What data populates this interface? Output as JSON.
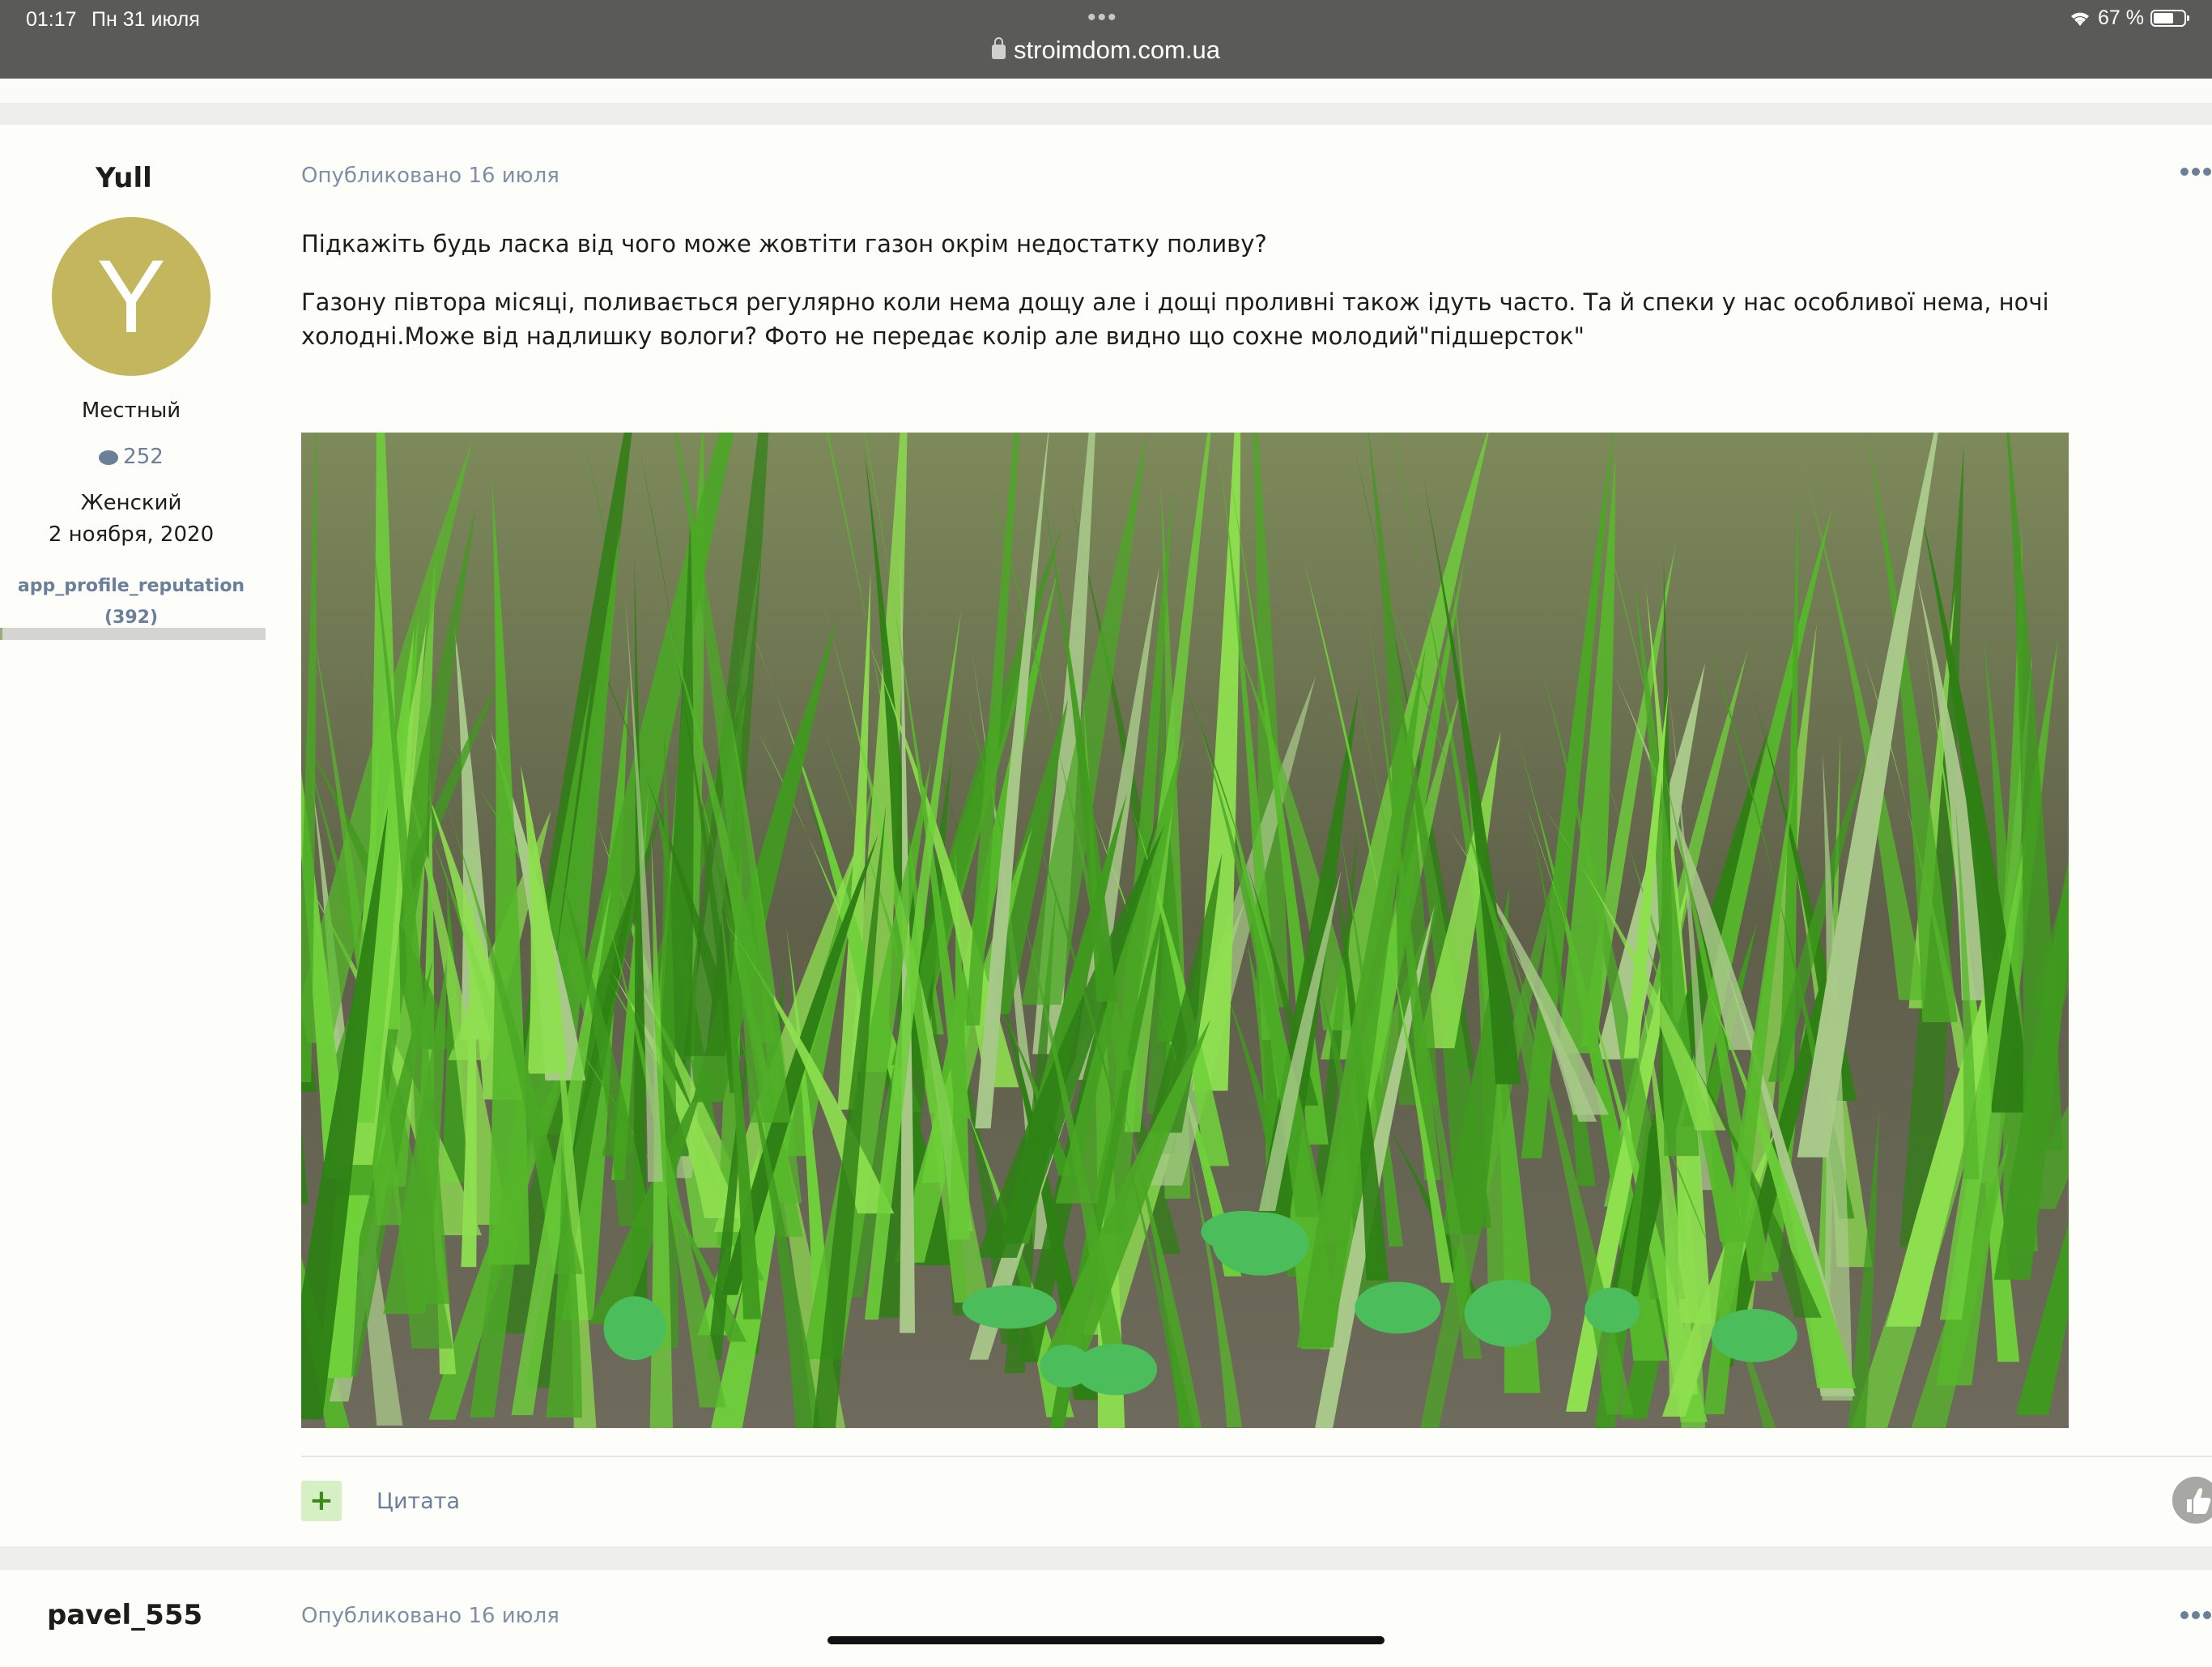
{
  "status_bar": {
    "time": "01:17",
    "date": "Пн 31 июля",
    "url": "stroimdom.com.ua",
    "battery": "67 %",
    "battery_level": 0.67,
    "icons": [
      "lock-icon",
      "wifi-icon",
      "battery-icon",
      "more-dots-icon"
    ]
  },
  "post1": {
    "author": {
      "name": "Yull",
      "avatar_letter": "Y",
      "avatar_color": "#c4b65c",
      "title": "Местный",
      "posts_count": "252",
      "gender": "Женский",
      "joined": "2 ноября, 2020",
      "reputation_label": "app_profile_reputation",
      "reputation_value": "(392)",
      "reputation_level": 0.01
    },
    "published": "Опубликовано 16 июля",
    "paragraphs": [
      "Підкажіть будь ласка від чого може жовтіти газон окрім недостатку поливу?",
      "Газону півтора місяці, поливається регулярно коли нема дощу але і дощі проливні також ідуть часто. Та й спеки у нас особливої нема, ночі холодні.Може від надлишку вологи? Фото не передає колір але видно що сохне молодий\"підшерсток\""
    ],
    "quote_label": "Цитата"
  },
  "post2": {
    "author_name": "pavel_555",
    "published": "Опубликовано 16 июля"
  },
  "colors": {
    "accent": "#6a7f9a",
    "status_bar": "#5a5a58",
    "plus_button": "#d6efc5"
  }
}
